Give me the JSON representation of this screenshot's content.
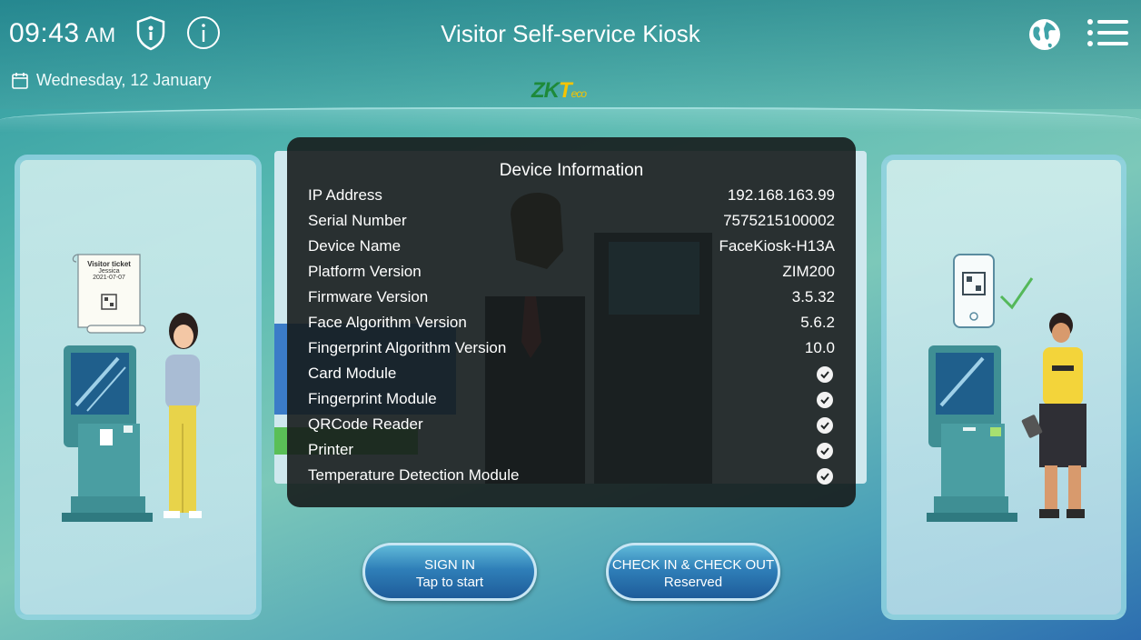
{
  "header": {
    "time": "09:43",
    "ampm": "AM",
    "date": "Wednesday, 12 January",
    "title": "Visitor Self-service Kiosk",
    "logo_main": "ZK",
    "logo_accent": "T",
    "logo_small": "eco"
  },
  "left_panel": {
    "ticket_title": "Visitor ticket",
    "ticket_name": "Jessica",
    "ticket_date": "2021-07-07"
  },
  "modal": {
    "title": "Device Information",
    "rows": [
      {
        "label": "IP Address",
        "value": "192.168.163.99"
      },
      {
        "label": "Serial Number",
        "value": "7575215100002"
      },
      {
        "label": "Device Name",
        "value": "FaceKiosk-H13A"
      },
      {
        "label": "Platform Version",
        "value": "ZIM200"
      },
      {
        "label": "Firmware Version",
        "value": "3.5.32"
      },
      {
        "label": "Face Algorithm Version",
        "value": "5.6.2"
      },
      {
        "label": "Fingerprint Algorithm Version",
        "value": "10.0"
      },
      {
        "label": "Card Module",
        "value": ""
      },
      {
        "label": "Fingerprint Module",
        "value": ""
      },
      {
        "label": "QRCode Reader",
        "value": ""
      },
      {
        "label": "Printer",
        "value": ""
      },
      {
        "label": "Temperature Detection Module",
        "value": ""
      }
    ]
  },
  "buttons": {
    "signin_line1": "SIGN IN",
    "signin_line2": "Tap to start",
    "check_line1": "CHECK IN & CHECK OUT",
    "check_line2": "Reserved"
  },
  "colors": {
    "accent": "#2f7fb8",
    "logo_green": "#1d8a3a",
    "logo_yellow": "#f5c400",
    "check_green": "#3fbf5a"
  }
}
